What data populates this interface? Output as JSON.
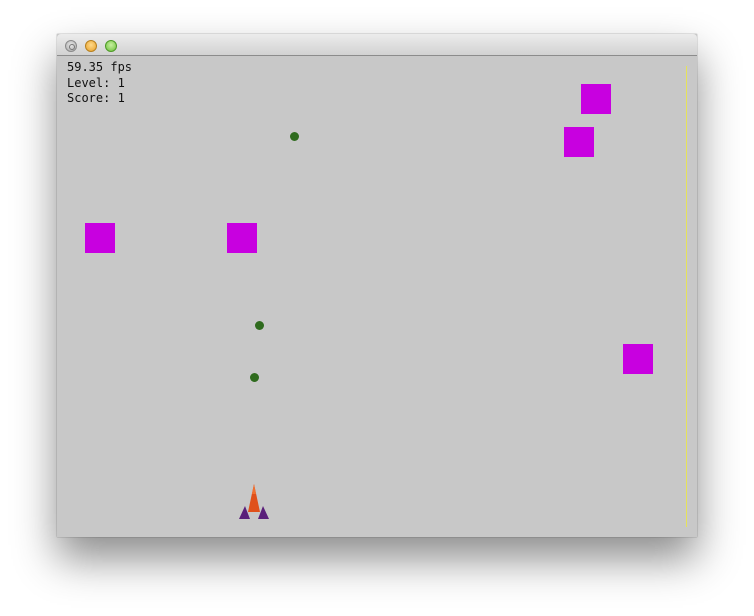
{
  "window": {
    "close_icon": "close-icon",
    "minimize_icon": "minimize-icon",
    "maximize_icon": "maximize-icon"
  },
  "hud": {
    "fps": "59.35 fps",
    "level": "Level: 1",
    "score": "Score: 1"
  },
  "colors": {
    "background": "#c8c8c8",
    "enemy": "#c800e0",
    "bullet": "#2f6b1e",
    "player_body": "#e0501a",
    "player_wings": "#5a1f7a",
    "boundary": "#e6e35a"
  }
}
